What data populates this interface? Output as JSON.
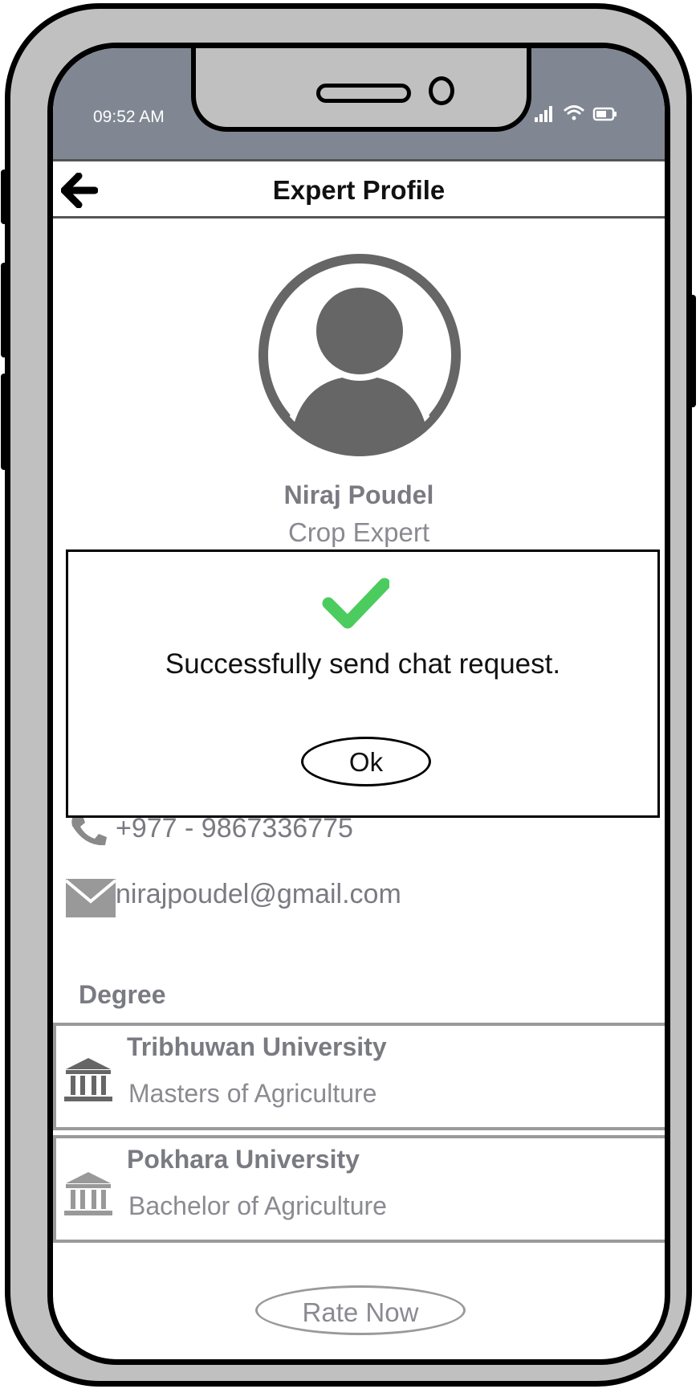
{
  "status_bar": {
    "time": "09:52 AM",
    "icons": [
      "signal-icon",
      "wifi-icon",
      "battery-icon"
    ]
  },
  "header": {
    "title": "Expert Profile",
    "back_icon": "arrow-left-icon"
  },
  "profile": {
    "name": "Niraj Poudel",
    "role": "Crop Expert",
    "avatar_icon": "user-avatar-icon"
  },
  "contact": {
    "phone": "+977 - 9867336775",
    "email": "nirajpoudel@gmail.com"
  },
  "degrees": {
    "heading": "Degree",
    "items": [
      {
        "university": "Tribhuwan University",
        "program": "Masters of Agriculture"
      },
      {
        "university": "Pokhara University",
        "program": "Bachelor of Agriculture"
      }
    ]
  },
  "rate_button": "Rate Now",
  "dialog": {
    "message": "Successfully send chat request.",
    "ok_label": "Ok",
    "check_color": "#4ccc5f"
  },
  "colors": {
    "status_bar_bg": "#808792",
    "muted_text": "#7a7a82",
    "phone_frame": "#c0c0c0"
  }
}
